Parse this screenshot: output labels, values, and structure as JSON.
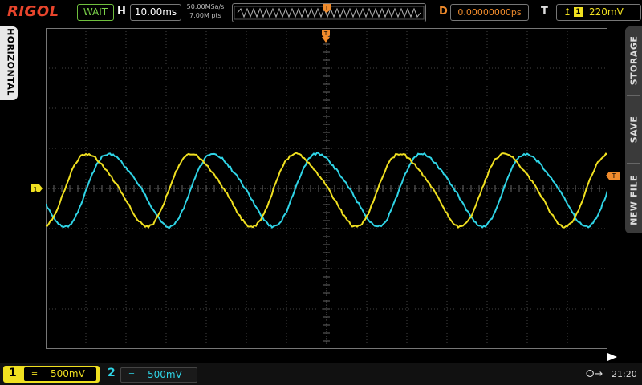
{
  "header": {
    "brand": "RIGOL",
    "run_status": "WAIT",
    "horizontal_label": "H",
    "timebase": "10.00ms",
    "sample_rate": "50.00MSa/s",
    "memory_depth": "7.00M pts",
    "delay_label": "D",
    "delay_value": "0.00000000ps",
    "trigger_label": "T",
    "trigger_source": "1",
    "trigger_level": "220mV"
  },
  "left_menu": {
    "horizontal": "HORIZONTAL"
  },
  "right_menu": {
    "storage": "STORAGE",
    "save": "SAVE",
    "new_file": "NEW FILE"
  },
  "channels": {
    "ch1": {
      "number": "1",
      "coupling": "═",
      "scale": "500mV",
      "color": "#f0e020"
    },
    "ch2": {
      "number": "2",
      "coupling": "═",
      "scale": "500mV",
      "color": "#2fd4e6"
    }
  },
  "markers": {
    "ch1_ground": "1",
    "trigger_pos": "T"
  },
  "system": {
    "usb_icon": "usb-icon",
    "time": "21:20"
  },
  "colors": {
    "accent": "#f08b2c",
    "status_ok": "#7cd24a",
    "logo": "#e8452c"
  }
}
